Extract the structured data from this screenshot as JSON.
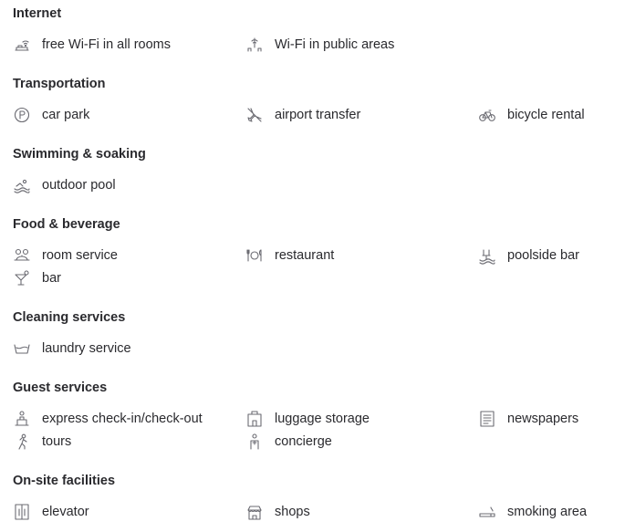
{
  "sections": [
    {
      "title": "Internet",
      "items": [
        {
          "label": "free Wi-Fi in all rooms",
          "icon": "wifi-room-icon"
        },
        {
          "label": "Wi-Fi in public areas",
          "icon": "wifi-public-icon"
        }
      ]
    },
    {
      "title": "Transportation",
      "items": [
        {
          "label": "car park",
          "icon": "parking-icon"
        },
        {
          "label": "airport transfer",
          "icon": "airplane-icon"
        },
        {
          "label": "bicycle rental",
          "icon": "bicycle-icon"
        }
      ]
    },
    {
      "title": "Swimming & soaking",
      "items": [
        {
          "label": "outdoor pool",
          "icon": "swimming-icon"
        }
      ]
    },
    {
      "title": "Food & beverage",
      "items": [
        {
          "label": "room service",
          "icon": "room-service-icon"
        },
        {
          "label": "restaurant",
          "icon": "restaurant-icon"
        },
        {
          "label": "poolside bar",
          "icon": "poolside-bar-icon"
        },
        {
          "label": "bar",
          "icon": "cocktail-icon"
        }
      ]
    },
    {
      "title": "Cleaning services",
      "items": [
        {
          "label": "laundry service",
          "icon": "laundry-icon"
        }
      ]
    },
    {
      "title": "Guest services",
      "items": [
        {
          "label": "express check-in/check-out",
          "icon": "check-in-icon"
        },
        {
          "label": "luggage storage",
          "icon": "luggage-icon"
        },
        {
          "label": "newspapers",
          "icon": "newspaper-icon"
        },
        {
          "label": "tours",
          "icon": "tours-icon"
        },
        {
          "label": "concierge",
          "icon": "concierge-icon"
        }
      ]
    },
    {
      "title": "On-site facilities",
      "items": [
        {
          "label": "elevator",
          "icon": "elevator-icon"
        },
        {
          "label": "shops",
          "icon": "shop-icon"
        },
        {
          "label": "smoking area",
          "icon": "smoking-icon"
        }
      ]
    }
  ]
}
